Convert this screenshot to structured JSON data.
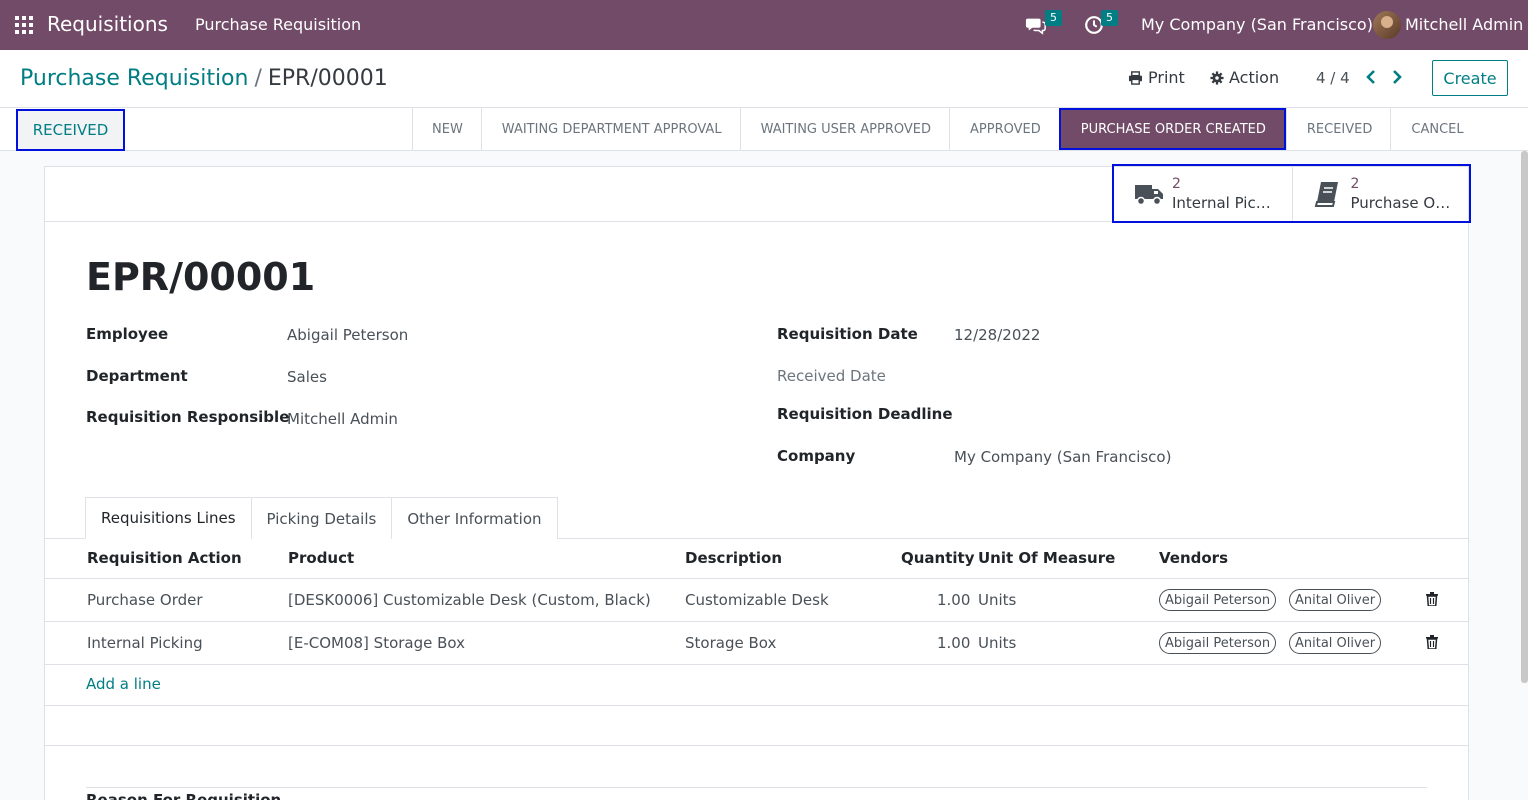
{
  "navbar": {
    "app_name": "Requisitions",
    "menu_item": "Purchase Requisition",
    "messages_count": "5",
    "activities_count": "5",
    "company": "My Company (San Francisco)",
    "user": "Mitchell Admin"
  },
  "control_panel": {
    "breadcrumb_parent": "Purchase Requisition",
    "breadcrumb_separator": "/",
    "breadcrumb_current": "EPR/00001",
    "print_label": "Print",
    "action_label": "Action",
    "pager": "4 / 4",
    "create_label": "Create"
  },
  "statusbar": {
    "received_button": "RECEIVED",
    "stages": [
      "NEW",
      "WAITING DEPARTMENT APPROVAL",
      "WAITING USER APPROVED",
      "APPROVED",
      "PURCHASE ORDER CREATED",
      "RECEIVED",
      "CANCEL"
    ],
    "active_stage": "PURCHASE ORDER CREATED"
  },
  "smart_buttons": [
    {
      "count": "2",
      "label": "Internal Pic…",
      "icon": "truck-icon"
    },
    {
      "count": "2",
      "label": "Purchase O…",
      "icon": "book-icon"
    }
  ],
  "record": {
    "title": "EPR/00001",
    "employee_label": "Employee",
    "employee": "Abigail Peterson",
    "department_label": "Department",
    "department": "Sales",
    "responsible_label": "Requisition Responsible",
    "responsible": "Mitchell Admin",
    "req_date_label": "Requisition Date",
    "req_date": "12/28/2022",
    "received_date_label": "Received Date",
    "deadline_label": "Requisition Deadline",
    "company_label": "Company",
    "company": "My Company (San Francisco)"
  },
  "tabs": [
    "Requisitions Lines",
    "Picking Details",
    "Other Information"
  ],
  "table": {
    "headers": [
      "Requisition Action",
      "Product",
      "Description",
      "Quantity",
      "Unit Of Measure",
      "Vendors"
    ],
    "rows": [
      {
        "action": "Purchase Order",
        "product": "[DESK0006] Customizable Desk (Custom, Black)",
        "description": "Customizable Desk",
        "quantity": "1.00",
        "uom": "Units",
        "vendors": [
          "Abigail Peterson",
          "Anital Oliver"
        ]
      },
      {
        "action": "Internal Picking",
        "product": "[E-COM08] Storage Box",
        "description": "Storage Box",
        "quantity": "1.00",
        "uom": "Units",
        "vendors": [
          "Abigail Peterson",
          "Anital Oliver"
        ]
      }
    ],
    "add_line": "Add a line"
  },
  "reason_label": "Reason For Requisition",
  "colors": {
    "brand": "#714b67",
    "accent": "#017e84",
    "highlight": "#0011dd"
  }
}
